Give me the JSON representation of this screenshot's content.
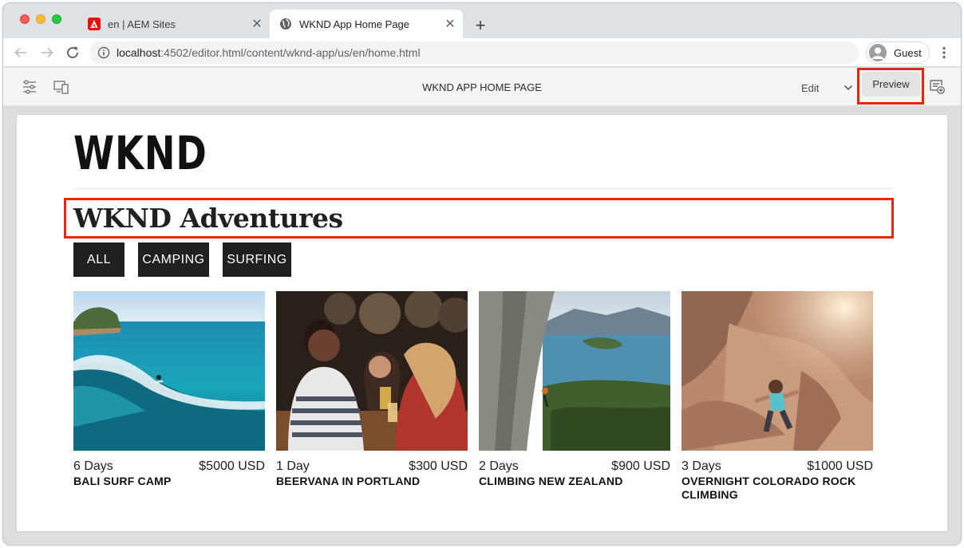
{
  "browser": {
    "tabs": [
      {
        "title": "en | AEM Sites",
        "favicon": "adobe-icon",
        "active": false
      },
      {
        "title": "WKND App Home Page",
        "favicon": "globe-icon",
        "active": true
      }
    ],
    "url_host": "localhost",
    "url_rest": ":4502/editor.html/content/wknd-app/us/en/home.html",
    "profile_label": "Guest"
  },
  "editor": {
    "page_title": "WKND APP HOME PAGE",
    "mode": "Edit",
    "preview_label": "Preview"
  },
  "page": {
    "logo": "WKND",
    "heading": "WKND Adventures",
    "filters": [
      "ALL",
      "CAMPING",
      "SURFING"
    ],
    "adventures": [
      {
        "duration": "6 Days",
        "price": "$5000 USD",
        "title": "BALI SURF CAMP"
      },
      {
        "duration": "1 Day",
        "price": "$300 USD",
        "title": "BEERVANA IN PORTLAND"
      },
      {
        "duration": "2 Days",
        "price": "$900 USD",
        "title": "CLIMBING NEW ZEALAND"
      },
      {
        "duration": "3 Days",
        "price": "$1000 USD",
        "title": "OVERNIGHT COLORADO ROCK CLIMBING"
      }
    ]
  },
  "colors": {
    "highlight": "#e8250f",
    "filter_bg": "#202020",
    "adobe_red": "#eb1000"
  }
}
